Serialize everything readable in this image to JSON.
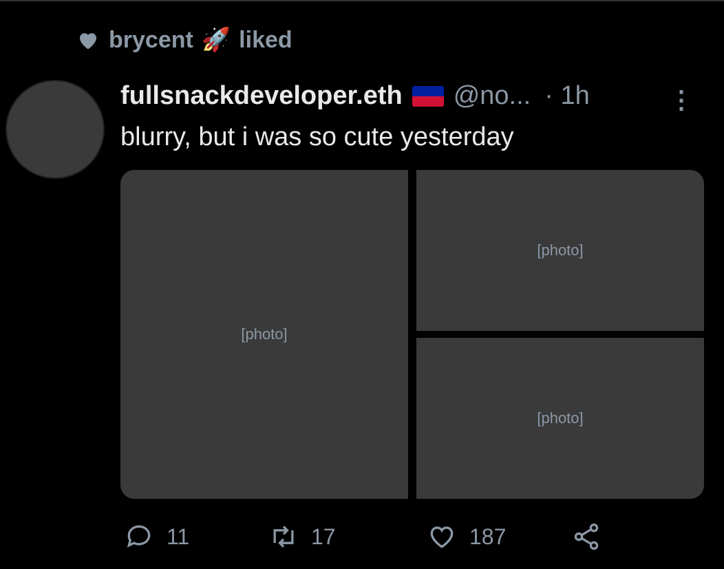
{
  "social_context": {
    "user": "brycent",
    "emoji": "🚀",
    "action": "liked"
  },
  "tweet": {
    "display_name": "fullsnackdeveloper.eth",
    "handle": "@no...",
    "time": "· 1h",
    "text": "blurry, but i was so cute yesterday",
    "media_placeholder": "[photo]"
  },
  "actions": {
    "replies": "11",
    "retweets": "17",
    "likes": "187"
  },
  "icons": [
    "heart-icon",
    "rocket-icon",
    "flag-icon",
    "more-icon",
    "reply-icon",
    "retweet-icon",
    "like-icon",
    "share-icon"
  ]
}
